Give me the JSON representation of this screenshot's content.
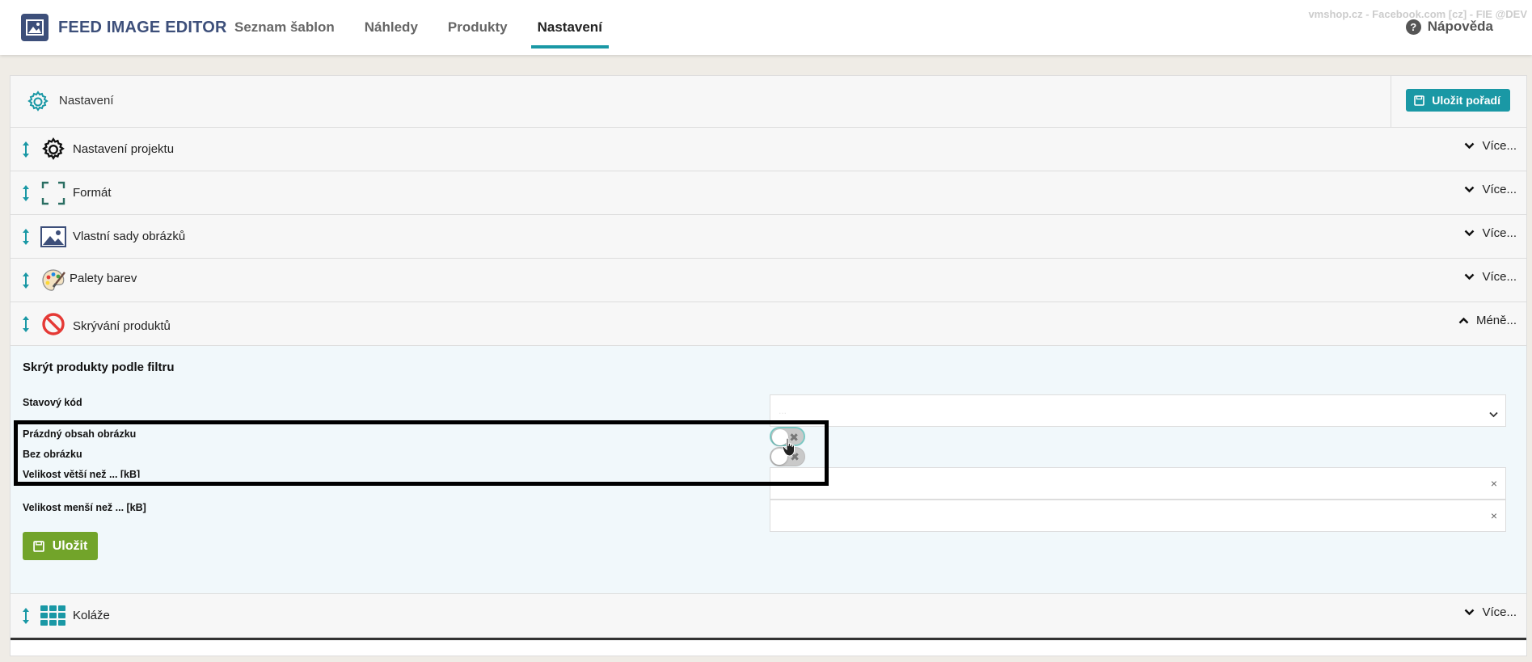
{
  "app": {
    "title": "FEED IMAGE EDITOR",
    "shop_info": "vmshop.cz - Facebook.com [cz] - FIE @DEV",
    "help_label": "Nápověda"
  },
  "nav": {
    "items": [
      {
        "label": "Seznam šablon",
        "active": false
      },
      {
        "label": "Náhledy",
        "active": false
      },
      {
        "label": "Produkty",
        "active": false
      },
      {
        "label": "Nastavení",
        "active": true
      }
    ]
  },
  "panel": {
    "title": "Nastavení",
    "save_order_label": "Uložit pořadí"
  },
  "sections": [
    {
      "label": "Nastavení projektu",
      "icon": "gear-icon",
      "toggle_label": "Více..."
    },
    {
      "label": "Formát",
      "icon": "frame-corners-icon",
      "toggle_label": "Více..."
    },
    {
      "label": "Vlastní sady obrázků",
      "icon": "image-icon",
      "toggle_label": "Více..."
    },
    {
      "label": "Palety barev",
      "icon": "palette-icon",
      "toggle_label": "Více..."
    },
    {
      "label": "Skrývání produktů",
      "icon": "prohibited-icon",
      "toggle_label": "Méně..."
    },
    {
      "label": "Koláže",
      "icon": "grid-icon",
      "toggle_label": "Více..."
    }
  ],
  "hide_form": {
    "title": "Skrýt produkty podle filtru",
    "status_code_label": "Stavový kód",
    "status_code_placeholder": "...",
    "empty_content_label": "Prázdný obsah obrázku",
    "no_image_label": "Bez obrázku",
    "size_greater_label": "Velikost větší než ... [kB]",
    "size_less_label": "Velikost menší než ... [kB]",
    "clear_symbol": "×",
    "toggle_off_symbol": "✖",
    "save_label": "Uložit"
  },
  "colors": {
    "accent": "#1a98a5",
    "brand": "#3d4f7a",
    "save_green": "#72a42a",
    "danger": "#e53935"
  }
}
